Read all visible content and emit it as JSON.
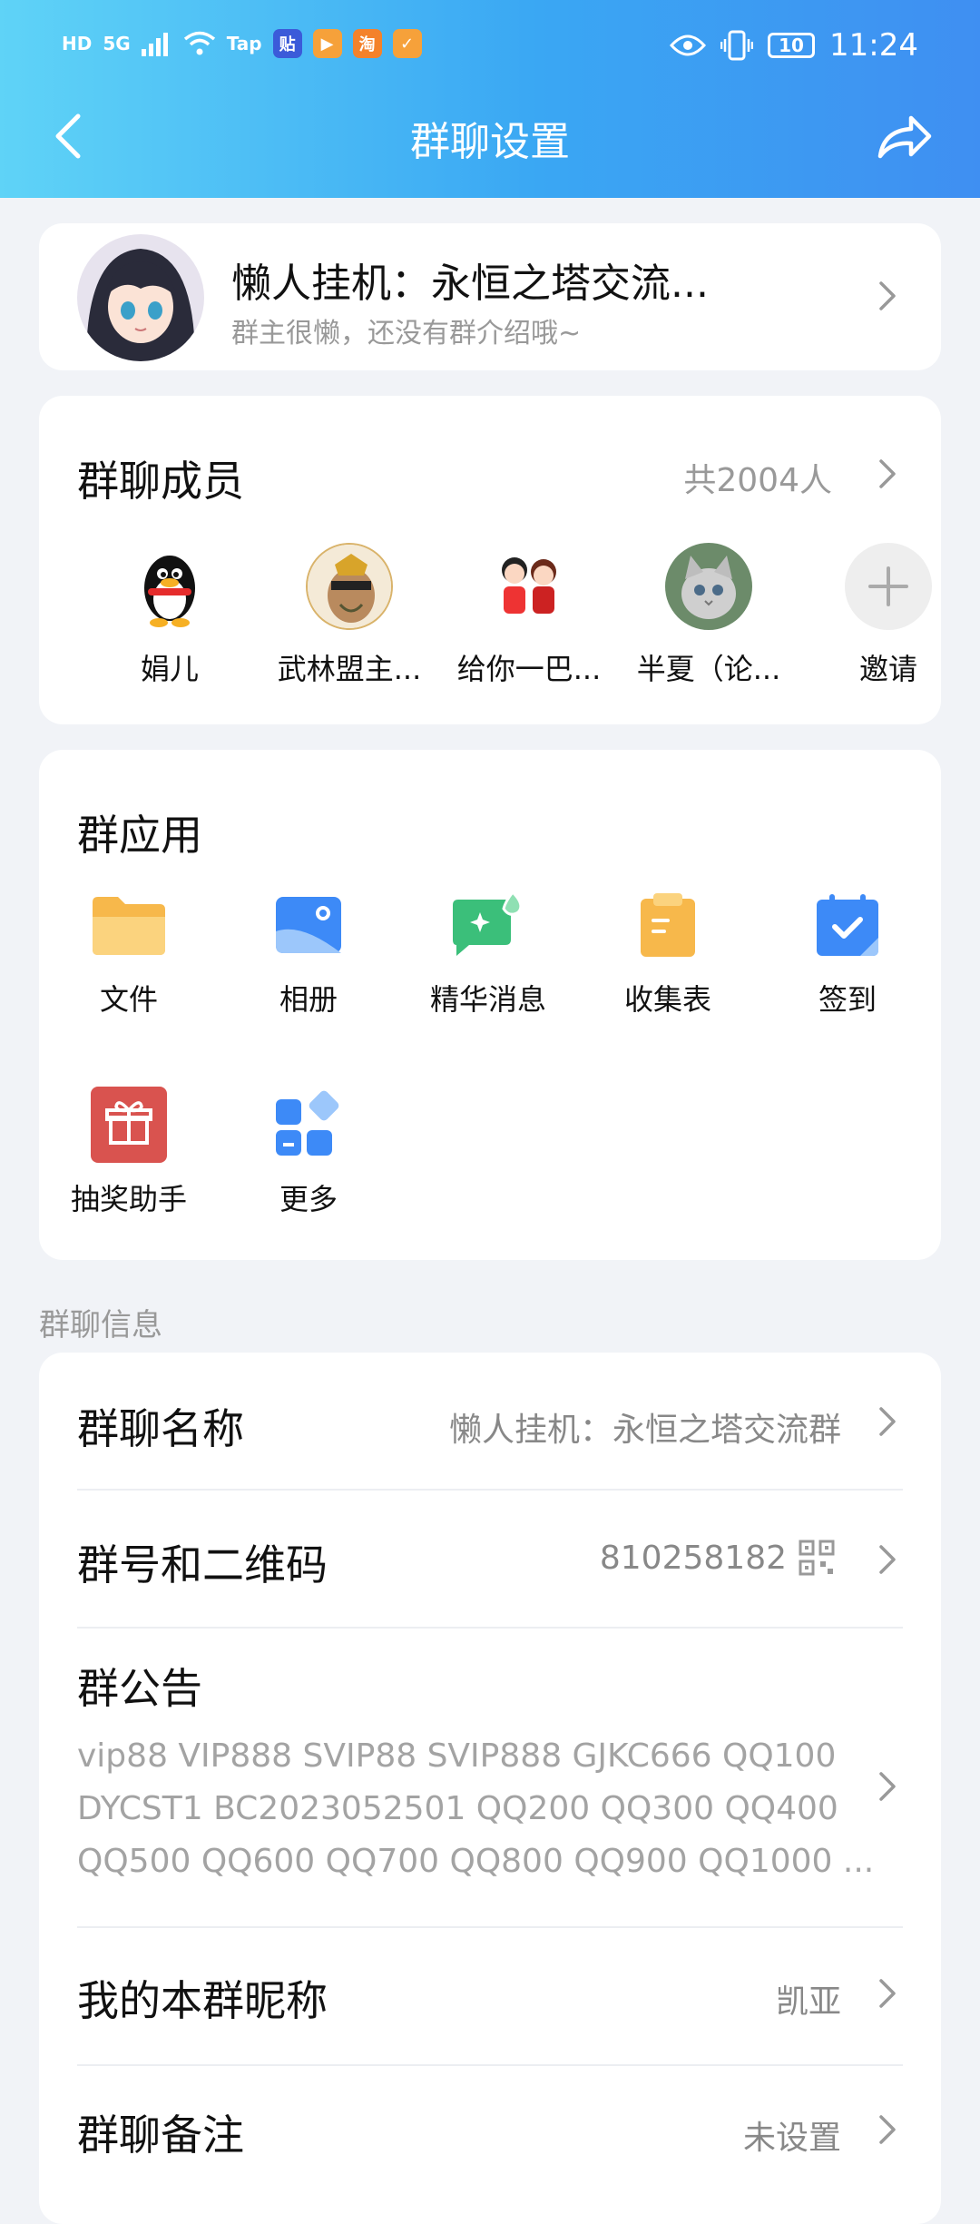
{
  "status_bar": {
    "network": "HD",
    "signal": "5G",
    "tap_label": "Tap",
    "battery": "10",
    "time": "11:24"
  },
  "nav": {
    "title": "群聊设置"
  },
  "group": {
    "name": "懒人挂机：永恒之塔交流...",
    "desc": "群主很懒，还没有群介绍哦~"
  },
  "members": {
    "title": "群聊成员",
    "count": "共2004人",
    "list": [
      {
        "name": "娟儿"
      },
      {
        "name": "武林盟主..."
      },
      {
        "name": "给你一巴..."
      },
      {
        "name": "半夏（论..."
      },
      {
        "name": "邀请"
      }
    ]
  },
  "apps": {
    "title": "群应用",
    "items": [
      {
        "label": "文件",
        "icon": "folder-icon",
        "color": "#f7b84b"
      },
      {
        "label": "相册",
        "icon": "album-icon",
        "color": "#3d8af7"
      },
      {
        "label": "精华消息",
        "icon": "highlight-message-icon",
        "color": "#3bbf7a"
      },
      {
        "label": "收集表",
        "icon": "clipboard-icon",
        "color": "#f7b84b"
      },
      {
        "label": "签到",
        "icon": "calendar-check-icon",
        "color": "#3d8af7"
      },
      {
        "label": "抽奖助手",
        "icon": "gift-icon",
        "color": "#d9534f"
      },
      {
        "label": "更多",
        "icon": "more-apps-icon",
        "color": "#3d8af7"
      }
    ]
  },
  "info": {
    "section_label": "群聊信息",
    "group_name_key": "群聊名称",
    "group_name_value": "懒人挂机：永恒之塔交流群",
    "group_number_key": "群号和二维码",
    "group_number_value": "810258182",
    "notice_key": "群公告",
    "notice_text": "vip88 VIP888 SVIP88 SVIP888 GJKC666 QQ100 DYCST1 BC2023052501 QQ200 QQ300 QQ400 QQ500 QQ600 QQ700 QQ800 QQ900 QQ1000 ...",
    "nickname_key": "我的本群昵称",
    "nickname_value": "凯亚",
    "remark_key": "群聊备注",
    "remark_value": "未设置"
  },
  "colors": {
    "header_start": "#5fd3f7",
    "header_end": "#3f8ff2",
    "background": "#f1f3f7"
  }
}
